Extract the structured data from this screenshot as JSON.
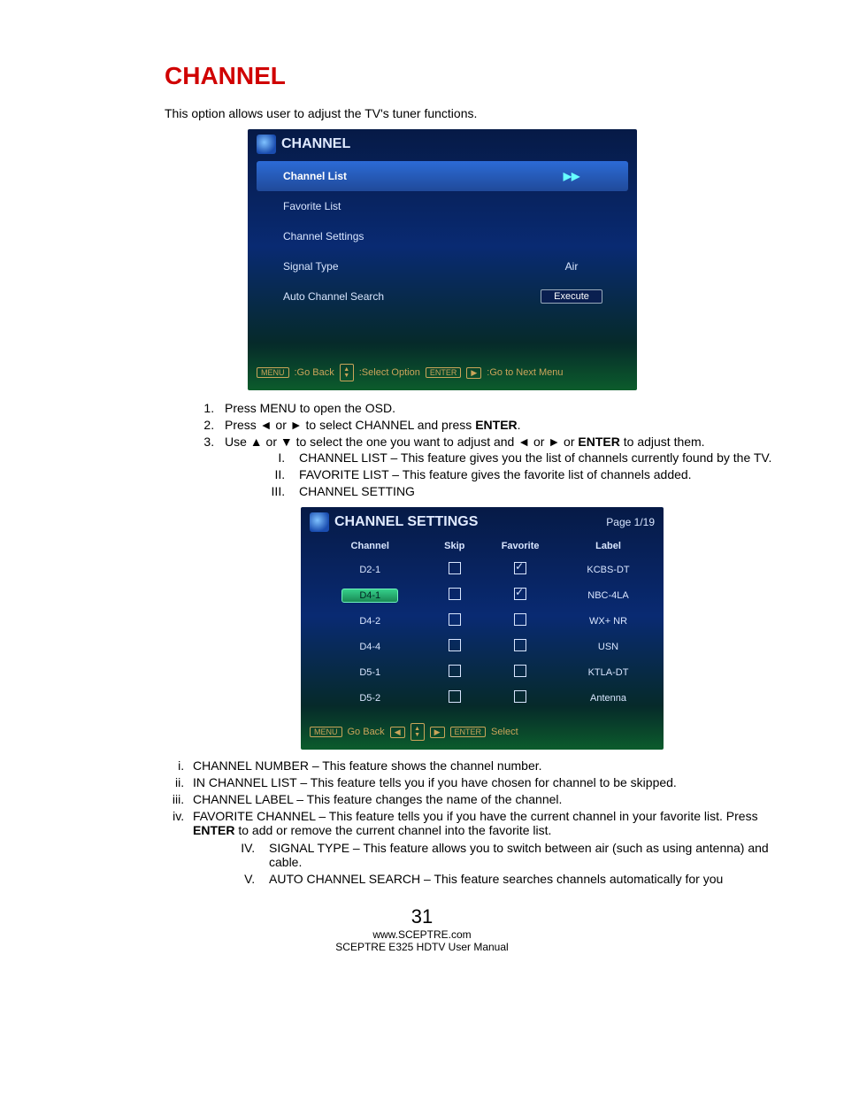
{
  "title": "CHANNEL",
  "intro": "This option allows user to adjust the TV's tuner functions.",
  "osd1": {
    "title": "CHANNEL",
    "items": [
      {
        "label": "Channel List",
        "value": "▶▶",
        "selected": true
      },
      {
        "label": "Favorite List",
        "value": "",
        "selected": false
      },
      {
        "label": "Channel Settings",
        "value": "",
        "selected": false
      },
      {
        "label": "Signal Type",
        "value": "Air",
        "selected": false
      },
      {
        "label": "Auto Channel Search",
        "value": "Execute",
        "button": true,
        "selected": false
      }
    ],
    "footer": {
      "menu": "MENU",
      "back": ":Go Back",
      "sel": ":Select Option",
      "enter": "ENTER",
      "next": ":Go to Next Menu"
    }
  },
  "steps": {
    "s1": "Press MENU to open the OSD.",
    "s2_a": "Press ◄ or ► to select CHANNEL and press ",
    "s2_b": "ENTER",
    "s2_c": ".",
    "s3_a": "Use ▲ or ▼ to select the one you want to adjust and ◄ or ► or ",
    "s3_b": "ENTER",
    "s3_c": " to adjust them.",
    "r1": "CHANNEL LIST – This feature gives you the list of channels currently found by the TV.",
    "r2": "FAVORITE LIST – This feature gives the favorite list of channels added.",
    "r3": "CHANNEL SETTING",
    "i1": "CHANNEL NUMBER – This feature shows the channel number.",
    "i2": "IN CHANNEL LIST – This feature tells you if you have chosen for channel to be skipped.",
    "i3": "CHANNEL LABEL – This feature changes the name of the channel.",
    "i4_a": "FAVORITE CHANNEL – This feature tells you if you have the current channel in your favorite list. Press ",
    "i4_b": "ENTER",
    "i4_c": " to add or remove the current channel into the favorite list.",
    "r4": "SIGNAL TYPE – This feature allows you to switch between air (such as using antenna) and cable.",
    "r5": "AUTO CHANNEL SEARCH – This feature searches channels automatically for you"
  },
  "osd2": {
    "title": "CHANNEL SETTINGS",
    "page": "Page 1/19",
    "headers": {
      "c1": "Channel",
      "c2": "Skip",
      "c3": "Favorite",
      "c4": "Label"
    },
    "rows": [
      {
        "ch": "D2-1",
        "skip": false,
        "fav": true,
        "label": "KCBS-DT",
        "selected": false
      },
      {
        "ch": "D4-1",
        "skip": false,
        "fav": true,
        "label": "NBC-4LA",
        "selected": true
      },
      {
        "ch": "D4-2",
        "skip": false,
        "fav": false,
        "label": "WX+ NR",
        "selected": false
      },
      {
        "ch": "D4-4",
        "skip": false,
        "fav": false,
        "label": "USN",
        "selected": false
      },
      {
        "ch": "D5-1",
        "skip": false,
        "fav": false,
        "label": "KTLA-DT",
        "selected": false
      },
      {
        "ch": "D5-2",
        "skip": false,
        "fav": false,
        "label": "Antenna",
        "selected": false
      }
    ],
    "footer": {
      "menu": "MENU",
      "back": "Go Back",
      "enter": "ENTER",
      "select": "Select"
    }
  },
  "footer": {
    "page": "31",
    "url": "www.SCEPTRE.com",
    "manual": "SCEPTRE E325 HDTV User Manual"
  }
}
